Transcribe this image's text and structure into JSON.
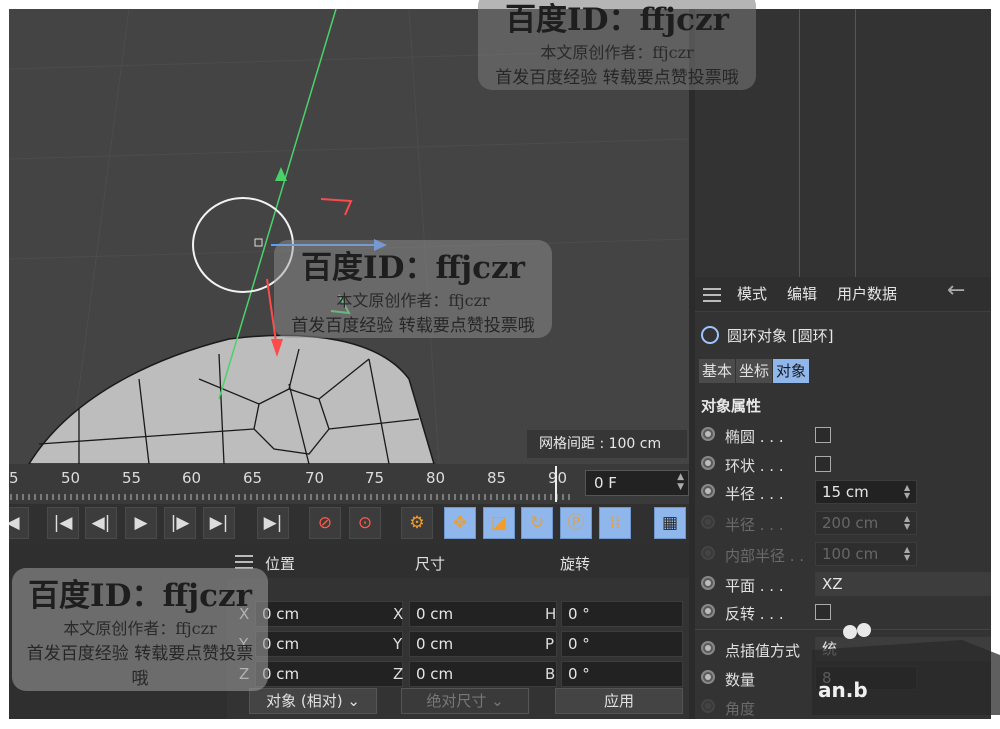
{
  "viewport": {
    "grid_label": "网格间距 : 100 cm"
  },
  "attributes": {
    "menu": [
      "模式",
      "编辑",
      "用户数据"
    ],
    "object_name": "圆环对象 [圆环]",
    "tabs": [
      "基本",
      "坐标",
      "对象"
    ],
    "section_title": "对象属性",
    "props": {
      "ellipse": "椭圆 . . .",
      "ring": "环状 . . .",
      "radius": "半径 . . .",
      "radius_value": "15 cm",
      "radius2": "半径 . . .",
      "radius2_value": "200 cm",
      "inner_radius": "内部半径 . .",
      "inner_radius_value": "100 cm",
      "plane": "平面 . . .",
      "plane_value": "XZ",
      "reverse": "反转 . . .",
      "interpolation": "点插值方式",
      "interpolation_value": "统",
      "count": "数量",
      "count_value": "8",
      "angle": "角度"
    }
  },
  "timeline": {
    "ticks": [
      "5",
      "50",
      "55",
      "60",
      "65",
      "70",
      "75",
      "80",
      "85",
      "90"
    ],
    "frame": "0 F"
  },
  "coordinates": {
    "headers": [
      "位置",
      "尺寸",
      "旋转"
    ],
    "rows": [
      {
        "a1": "X",
        "v1": "0 cm",
        "a2": "X",
        "v2": "0 cm",
        "a3": "H",
        "v3": "0 °"
      },
      {
        "a1": "Y",
        "v1": "0 cm",
        "a2": "Y",
        "v2": "0 cm",
        "a3": "P",
        "v3": "0 °"
      },
      {
        "a1": "Z",
        "v1": "0 cm",
        "a2": "Z",
        "v2": "0 cm",
        "a3": "B",
        "v3": "0 °"
      }
    ],
    "mode": "对象 (相对)",
    "size_mode": "绝对尺寸",
    "apply": "应用"
  },
  "watermark": {
    "title": "百度ID：ffjczr",
    "line1": "本文原创作者：ffjczr",
    "line2": "首发百度经验  转载要点赞投票哦"
  },
  "logo_text": "an.b"
}
